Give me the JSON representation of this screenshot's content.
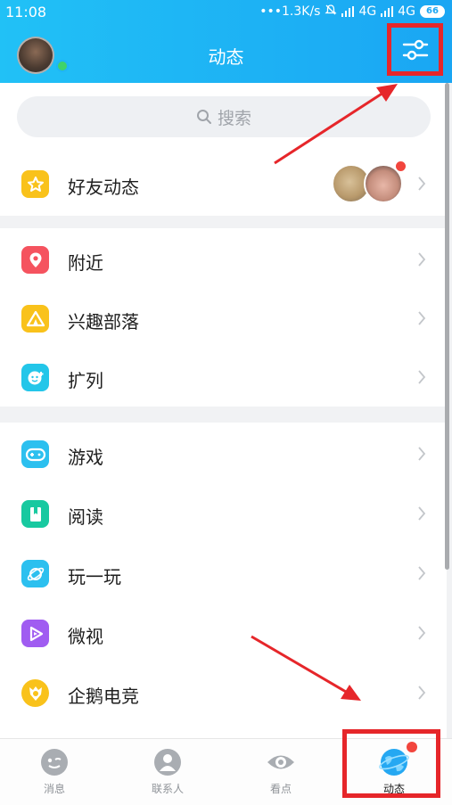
{
  "status_bar": {
    "time": "11:08",
    "network_speed": "•••1.3K/s",
    "signal_1": "4G",
    "signal_2": "4G",
    "battery": "66"
  },
  "header": {
    "title": "动态"
  },
  "search": {
    "placeholder": "搜索"
  },
  "friends_feed": {
    "label": "好友动态"
  },
  "group_1": [
    {
      "label": "附近",
      "icon": "location-icon",
      "color": "#f5535f"
    },
    {
      "label": "兴趣部落",
      "icon": "tent-icon",
      "color": "#f9c21b"
    },
    {
      "label": "扩列",
      "icon": "smile-icon",
      "color": "#23c6e9"
    }
  ],
  "group_2": [
    {
      "label": "游戏",
      "icon": "gamepad-icon",
      "color": "#2cc0ef"
    },
    {
      "label": "阅读",
      "icon": "book-icon",
      "color": "#18c9a0"
    },
    {
      "label": "玩一玩",
      "icon": "planet-icon",
      "color": "#2cc0ef"
    },
    {
      "label": "微视",
      "icon": "play-icon",
      "color": "#a05cf1"
    },
    {
      "label": "企鹅电竞",
      "icon": "esports-icon",
      "color": "#f9c21b"
    }
  ],
  "tabbar": {
    "tabs": [
      {
        "label": "消息",
        "icon": "message-icon"
      },
      {
        "label": "联系人",
        "icon": "contacts-icon"
      },
      {
        "label": "看点",
        "icon": "eye-icon"
      },
      {
        "label": "动态",
        "icon": "globe-icon"
      }
    ],
    "active": "动态"
  },
  "colors": {
    "header_gradient_start": "#21c1f6",
    "header_gradient_end": "#1aa6f3",
    "annotation_red": "#e6262a",
    "badge_red": "#f2453d"
  }
}
